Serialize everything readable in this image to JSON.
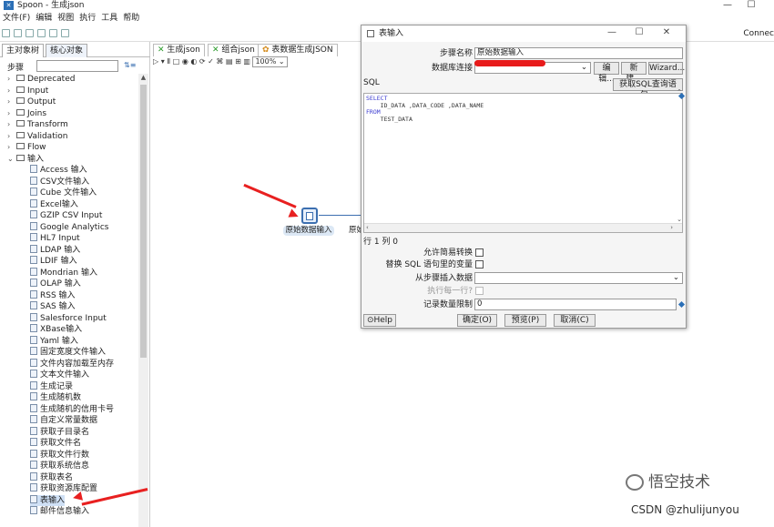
{
  "window": {
    "title": "Spoon - 生成json",
    "icon": "spoon-icon",
    "controls": [
      "—",
      "☐"
    ]
  },
  "menu": [
    "文件(F)",
    "编辑",
    "视图",
    "执行",
    "工具",
    "帮助"
  ],
  "toolbar": {
    "connect": "Connec"
  },
  "left_panel": {
    "tabs": [
      "主对象树",
      "核心对象"
    ],
    "steps_label": "步骤",
    "categories": [
      "Deprecated",
      "Input",
      "Output",
      "Joins",
      "Transform",
      "Validation",
      "Flow"
    ],
    "expanded_category": "输入",
    "steps": [
      "Access 输入",
      "CSV文件输入",
      "Cube 文件输入",
      "Excel输入",
      "GZIP CSV Input",
      "Google Analytics",
      "HL7 Input",
      "LDAP 输入",
      "LDIF 输入",
      "Mondrian 输入",
      "OLAP 输入",
      "RSS 输入",
      "SAS 输入",
      "Salesforce Input",
      "XBase输入",
      "Yaml 输入",
      "固定宽度文件输入",
      "文件内容加载至内存",
      "文本文件输入",
      "生成记录",
      "生成随机数",
      "生成随机的信用卡号",
      "自定义常量数据",
      "获取子目录名",
      "获取文件名",
      "获取文件行数",
      "获取系统信息",
      "获取表名",
      "获取资源库配置",
      "表输入",
      "邮件信息输入"
    ],
    "selected_step": "表输入"
  },
  "canvas": {
    "tabs": [
      "生成json",
      "组合json",
      "表数据生成JSON"
    ],
    "zoom": "100%",
    "step_name": "原始数据输入",
    "next_step_partial": "原始"
  },
  "dialog": {
    "title": "表输入",
    "step_name_label": "步骤名称",
    "step_name_value": "原始数据输入",
    "db_conn_label": "数据库连接",
    "buttons_conn": [
      "编辑...",
      "新建...",
      "Wizard..."
    ],
    "sql_label": "SQL",
    "get_sql_button": "获取SQL查询语句...",
    "sql_lines": [
      {
        "kw": "SELECT",
        "text": ""
      },
      {
        "kw": "",
        "text": "    ID_DATA ,DATA_CODE ,DATA_NAME"
      },
      {
        "kw": "FROM",
        "text": ""
      },
      {
        "kw": "",
        "text": "    TEST_DATA"
      }
    ],
    "cursor_pos": "行 1 列 0",
    "lazy_conversion_label": "允许简易转换",
    "replace_vars_label": "替换 SQL 语句里的变量",
    "insert_from_step_label": "从步骤插入数据",
    "execute_each_row_label": "执行每一行?",
    "limit_label": "记录数量限制",
    "limit_value": "0",
    "help_button": "Help",
    "ok_button": "确定(O)",
    "preview_button": "预览(P)",
    "cancel_button": "取消(C)"
  },
  "watermark": {
    "wechat": "悟空技术",
    "csdn": "CSDN @zhulijunyou"
  }
}
